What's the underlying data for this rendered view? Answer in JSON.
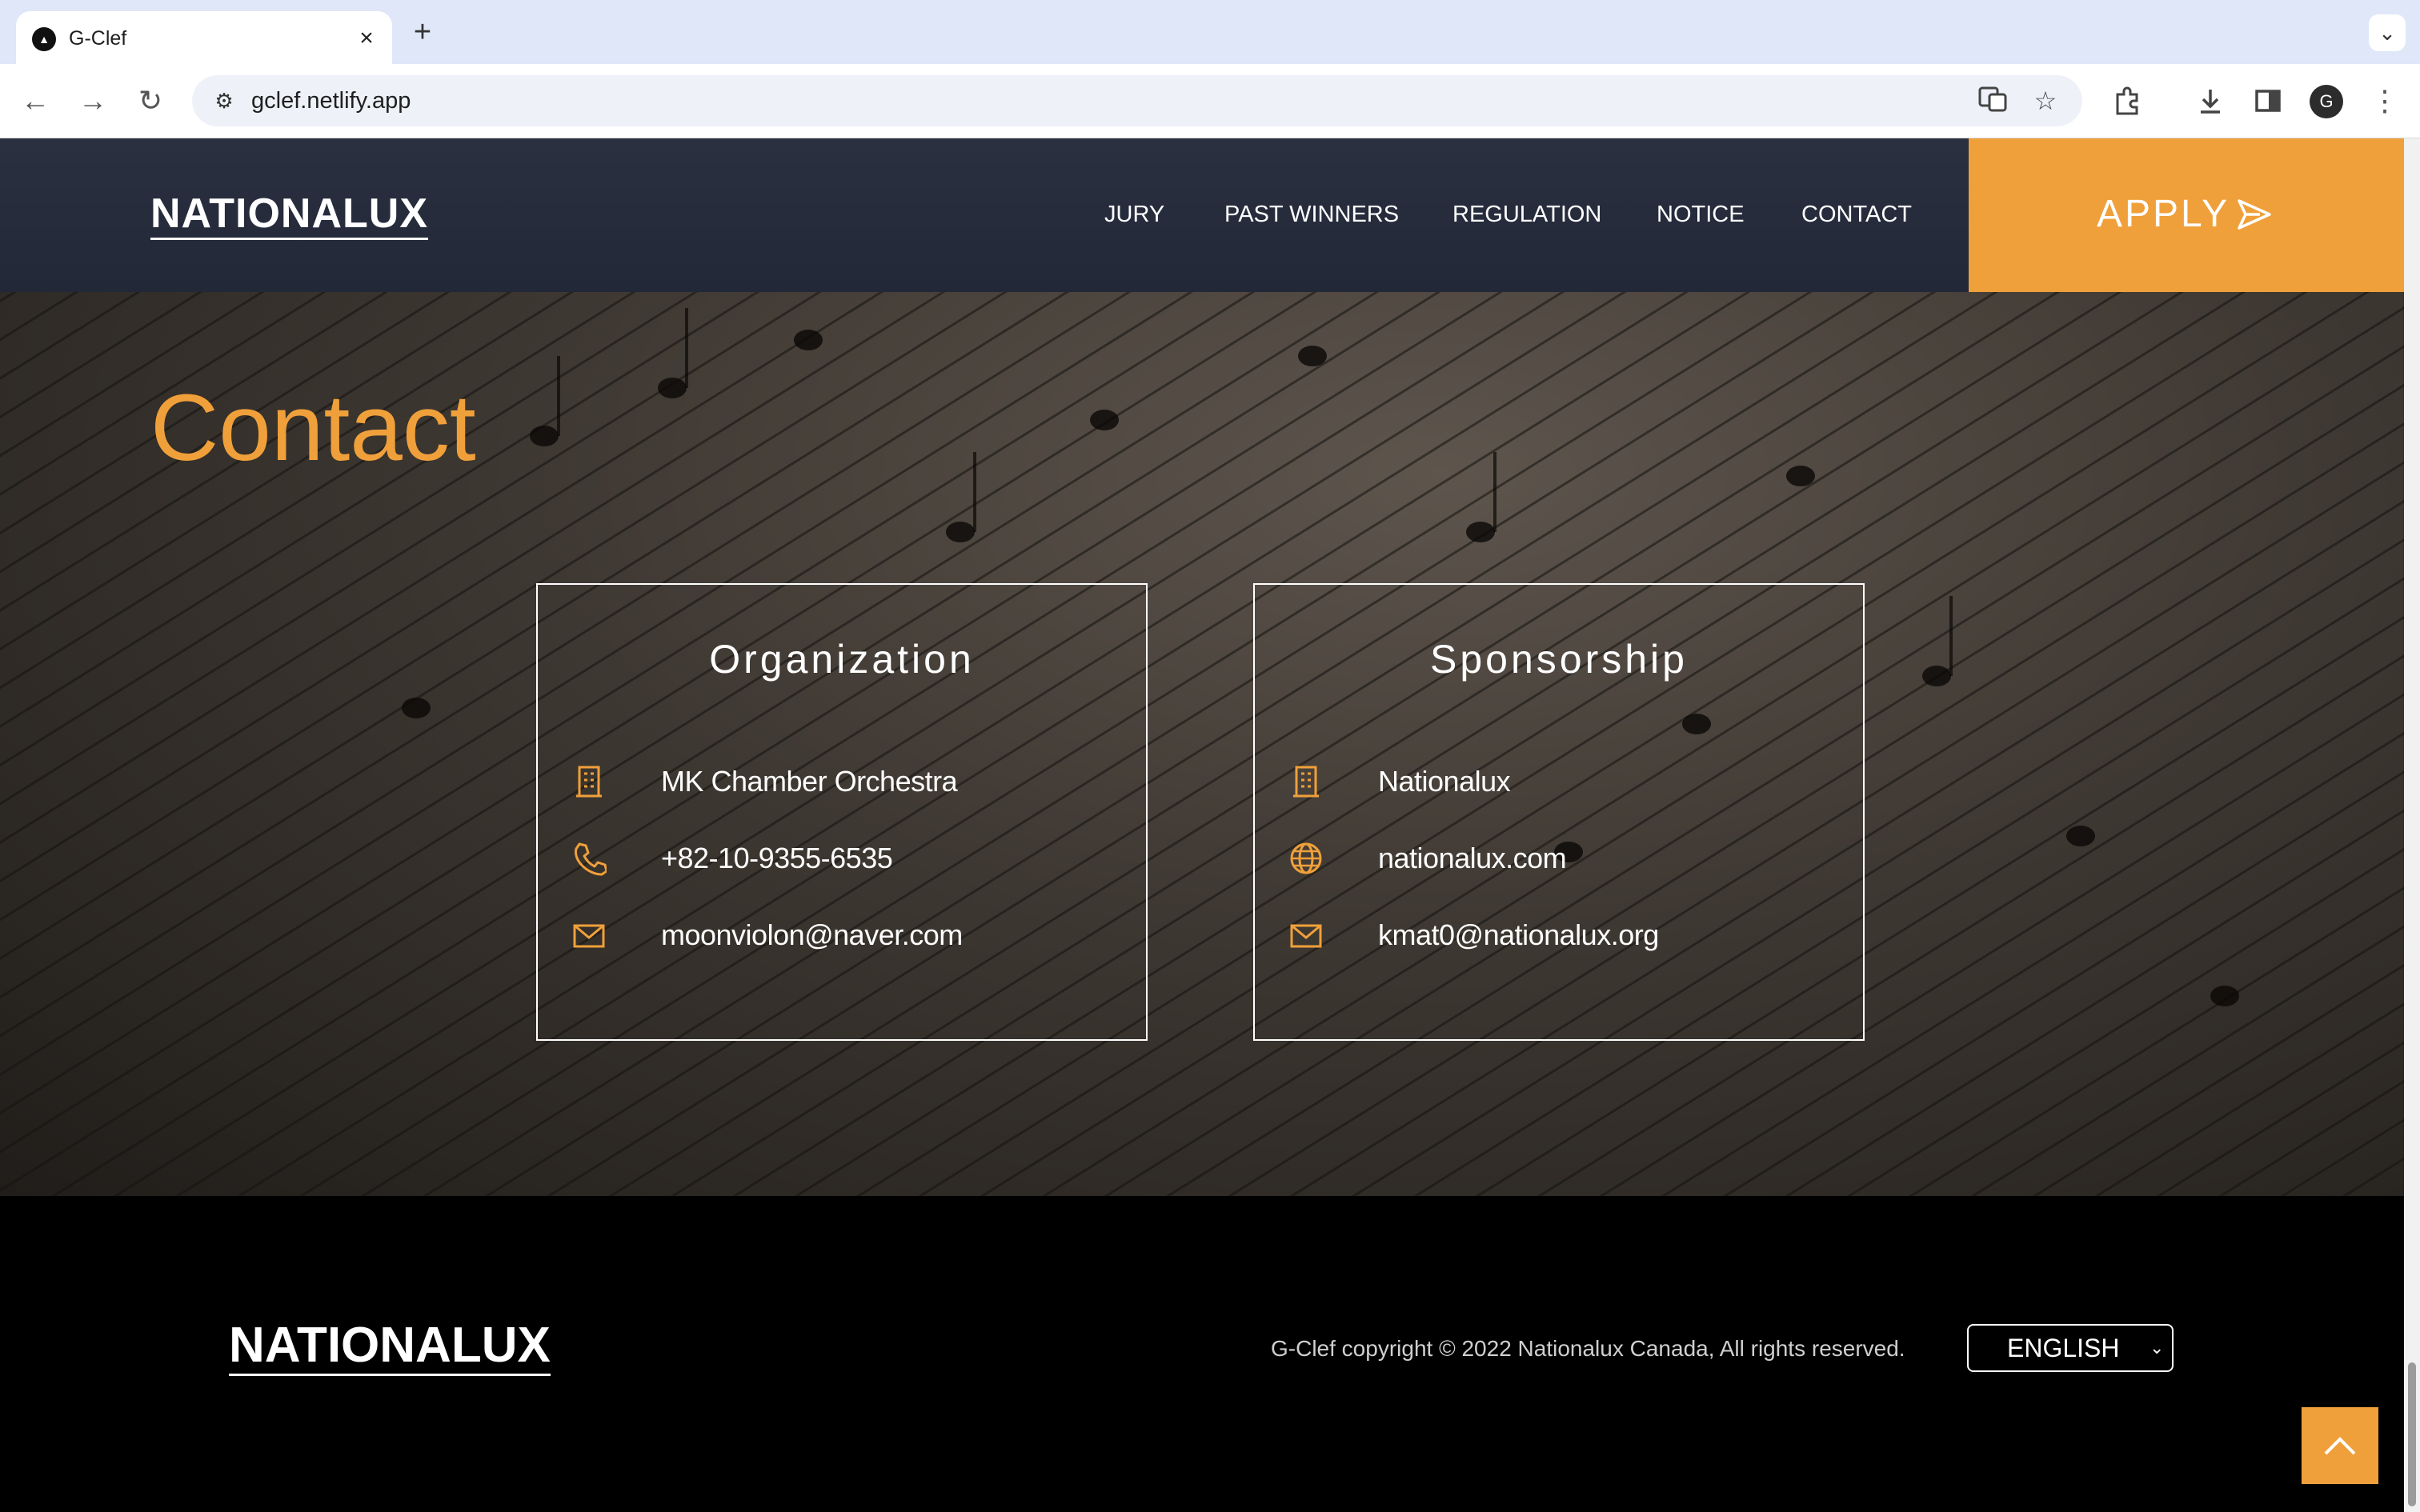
{
  "browser": {
    "tab_title": "G-Clef",
    "new_tab_symbol": "+",
    "close_symbol": "×",
    "url": "gclef.netlify.app"
  },
  "header": {
    "logo": "NATIONALUX",
    "nav": [
      "JURY",
      "PAST WINNERS",
      "REGULATION",
      "NOTICE",
      "CONTACT"
    ],
    "apply_label": "APPLY"
  },
  "hero": {
    "title": "Contact",
    "cards": [
      {
        "title": "Organization",
        "rows": [
          {
            "icon": "building-icon",
            "text": "MK Chamber Orchestra"
          },
          {
            "icon": "phone-icon",
            "text": "+82-10-9355-6535"
          },
          {
            "icon": "mail-icon",
            "text": "moonviolon@naver.com"
          }
        ]
      },
      {
        "title": "Sponsorship",
        "rows": [
          {
            "icon": "building-icon",
            "text": "Nationalux"
          },
          {
            "icon": "globe-icon",
            "text": "nationalux.com"
          },
          {
            "icon": "mail-icon",
            "text": "kmat0@nationalux.org"
          }
        ]
      }
    ]
  },
  "footer": {
    "logo": "NATIONALUX",
    "copyright": "G-Clef copyright © 2022 Nationalux Canada, All rights reserved.",
    "language_selected": "ENGLISH"
  },
  "colors": {
    "accent": "#f0a03a",
    "header_bg": "#252b3b",
    "footer_bg": "#000000"
  }
}
